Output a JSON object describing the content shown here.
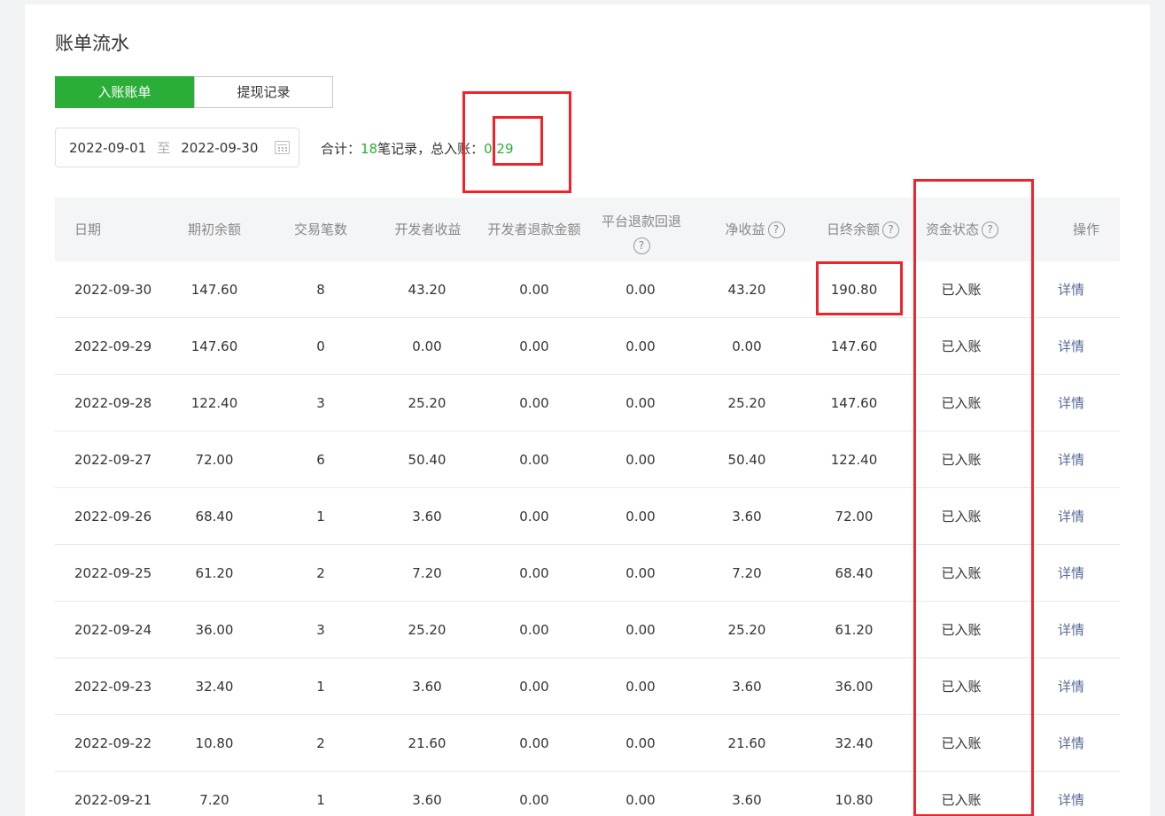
{
  "page": {
    "title": "账单流水"
  },
  "tabs": [
    {
      "label": "入账账单",
      "active": true
    },
    {
      "label": "提现记录",
      "active": false
    }
  ],
  "filter": {
    "start_date": "2022-09-01",
    "separator": "至",
    "end_date": "2022-09-30"
  },
  "summary": {
    "prefix": "合计：",
    "count": "18",
    "middle": "笔记录，总入账：",
    "total": "0.29"
  },
  "table": {
    "columns": [
      {
        "label": "日期"
      },
      {
        "label": "期初余额"
      },
      {
        "label": "交易笔数"
      },
      {
        "label": "开发者收益"
      },
      {
        "label": "开发者退款金额"
      },
      {
        "label": "平台退款回退"
      },
      {
        "label": "净收益"
      },
      {
        "label": "日终余额"
      },
      {
        "label": "资金状态"
      },
      {
        "label": "操作"
      }
    ],
    "help_glyph": "?",
    "rows": [
      [
        "2022-09-30",
        "147.60",
        "8",
        "43.20",
        "0.00",
        "0.00",
        "43.20",
        "190.80",
        "已入账",
        "详情"
      ],
      [
        "2022-09-29",
        "147.60",
        "0",
        "0.00",
        "0.00",
        "0.00",
        "0.00",
        "147.60",
        "已入账",
        "详情"
      ],
      [
        "2022-09-28",
        "122.40",
        "3",
        "25.20",
        "0.00",
        "0.00",
        "25.20",
        "147.60",
        "已入账",
        "详情"
      ],
      [
        "2022-09-27",
        "72.00",
        "6",
        "50.40",
        "0.00",
        "0.00",
        "50.40",
        "122.40",
        "已入账",
        "详情"
      ],
      [
        "2022-09-26",
        "68.40",
        "1",
        "3.60",
        "0.00",
        "0.00",
        "3.60",
        "72.00",
        "已入账",
        "详情"
      ],
      [
        "2022-09-25",
        "61.20",
        "2",
        "7.20",
        "0.00",
        "0.00",
        "7.20",
        "68.40",
        "已入账",
        "详情"
      ],
      [
        "2022-09-24",
        "36.00",
        "3",
        "25.20",
        "0.00",
        "0.00",
        "25.20",
        "61.20",
        "已入账",
        "详情"
      ],
      [
        "2022-09-23",
        "32.40",
        "1",
        "3.60",
        "0.00",
        "0.00",
        "3.60",
        "36.00",
        "已入账",
        "详情"
      ],
      [
        "2022-09-22",
        "10.80",
        "2",
        "21.60",
        "0.00",
        "0.00",
        "21.60",
        "32.40",
        "已入账",
        "详情"
      ],
      [
        "2022-09-21",
        "7.20",
        "1",
        "3.60",
        "0.00",
        "0.00",
        "3.60",
        "10.80",
        "已入账",
        "详情"
      ]
    ]
  },
  "colors": {
    "accent_green": "#2aae38",
    "link": "#576b95",
    "annotation_red": "#f0232a"
  },
  "icons": [
    "calendar-icon",
    "question-icon"
  ]
}
